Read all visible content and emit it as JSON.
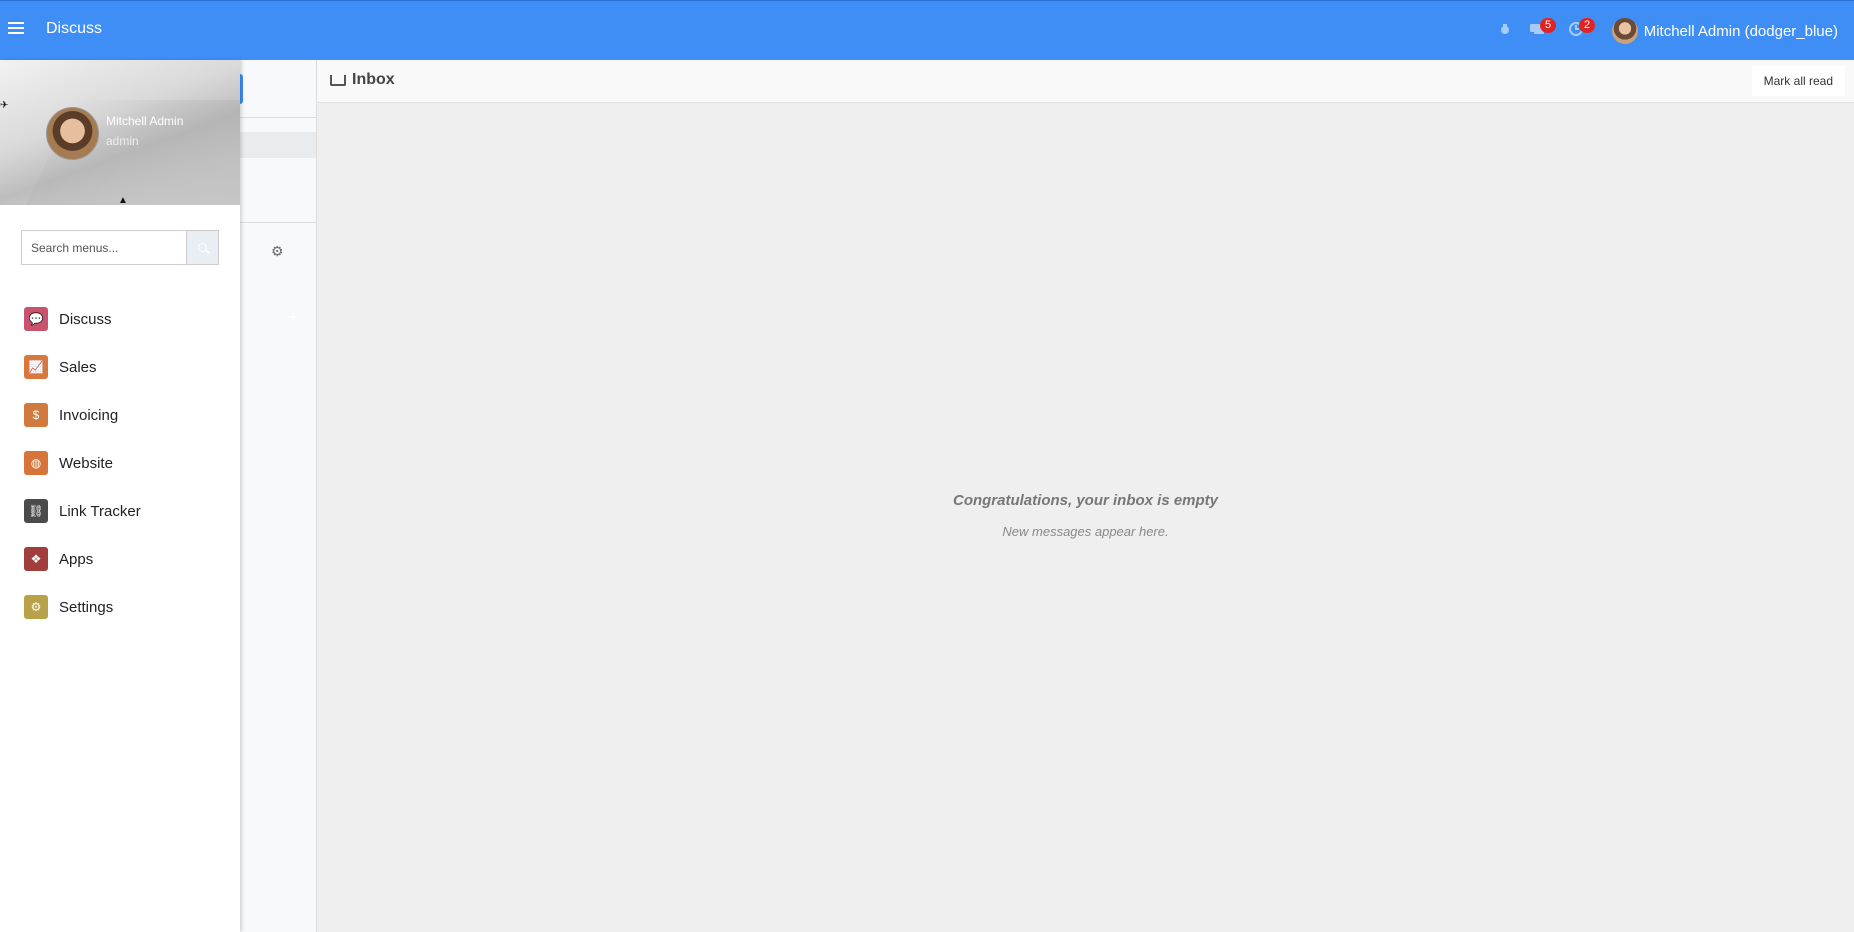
{
  "navbar": {
    "app_name": "Discuss",
    "messages_count": "5",
    "activities_count": "2",
    "user_label": "Mitchell Admin (dodger_blue)"
  },
  "drawer": {
    "user_name": "Mitchell Admin",
    "user_login": "admin",
    "search_placeholder": "Search menus...",
    "items": [
      {
        "label": "Discuss",
        "icon": "discuss-icon",
        "color": "#c9536f"
      },
      {
        "label": "Sales",
        "icon": "sales-chart-icon",
        "color": "#d9773e"
      },
      {
        "label": "Invoicing",
        "icon": "invoice-icon",
        "color": "#d07a3d"
      },
      {
        "label": "Website",
        "icon": "globe-icon",
        "color": "#d6743a"
      },
      {
        "label": "Link Tracker",
        "icon": "link-icon",
        "color": "#4b4b4b"
      },
      {
        "label": "Apps",
        "icon": "apps-icon",
        "color": "#a23d3d"
      },
      {
        "label": "Settings",
        "icon": "gear-icon",
        "color": "#b7a24a"
      }
    ]
  },
  "control_panel": {
    "title": "Inbox",
    "mark_all_read": "Mark all read"
  },
  "empty_state": {
    "title": "Congratulations, your inbox is empty",
    "subtitle": "New messages appear here."
  }
}
